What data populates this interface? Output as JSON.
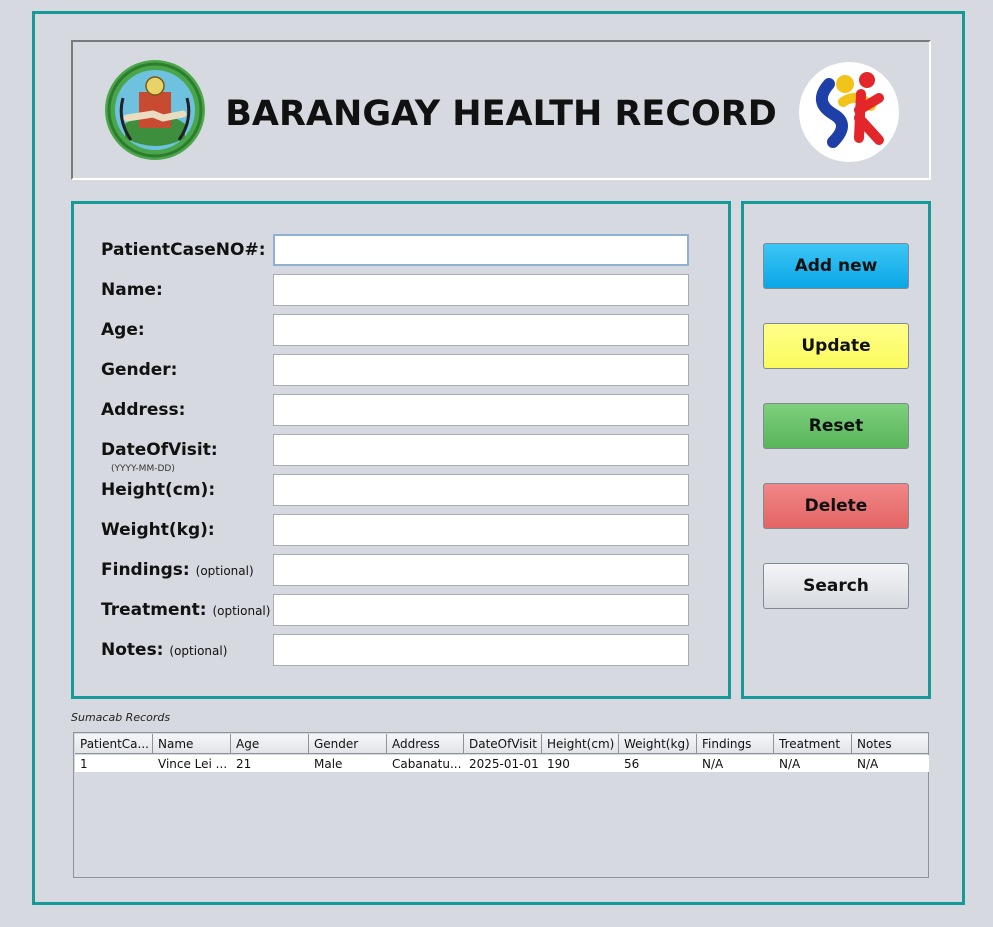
{
  "header": {
    "title": "BARANGAY HEALTH RECORD"
  },
  "form": {
    "fields": [
      {
        "label": "PatientCaseNO#:",
        "optional": "",
        "value": ""
      },
      {
        "label": "Name:",
        "optional": "",
        "value": ""
      },
      {
        "label": "Age:",
        "optional": "",
        "value": ""
      },
      {
        "label": "Gender:",
        "optional": "",
        "value": ""
      },
      {
        "label": "Address:",
        "optional": "",
        "value": ""
      },
      {
        "label": "DateOfVisit:",
        "optional": "",
        "value": ""
      },
      {
        "label": "Height(cm):",
        "optional": "",
        "value": ""
      },
      {
        "label": "Weight(kg):",
        "optional": "",
        "value": ""
      },
      {
        "label": "Findings:",
        "optional": "(optional)",
        "value": ""
      },
      {
        "label": "Treatment:",
        "optional": "(optional)",
        "value": ""
      },
      {
        "label": "Notes:",
        "optional": "(optional)",
        "value": ""
      }
    ],
    "date_hint": "(YYYY-MM-DD)"
  },
  "buttons": {
    "add": "Add new",
    "update": "Update",
    "reset": "Reset",
    "delete": "Delete",
    "search": "Search"
  },
  "records": {
    "title": "Sumacab Records",
    "columns": [
      "PatientCa...",
      "Name",
      "Age",
      "Gender",
      "Address",
      "DateOfVisit",
      "Height(cm)",
      "Weight(kg)",
      "Findings",
      "Treatment",
      "Notes"
    ],
    "rows": [
      [
        "1",
        "Vince Lei ...",
        "21",
        "Male",
        "Cabanatu...",
        "2025-01-01",
        "190",
        "56",
        "N/A",
        "N/A",
        "N/A"
      ]
    ]
  },
  "colors": {
    "accent_border": "#159a98",
    "add_button": "#0aa6e6",
    "update_button": "#fafa5c",
    "reset_button": "#58b558",
    "delete_button": "#e46464"
  }
}
